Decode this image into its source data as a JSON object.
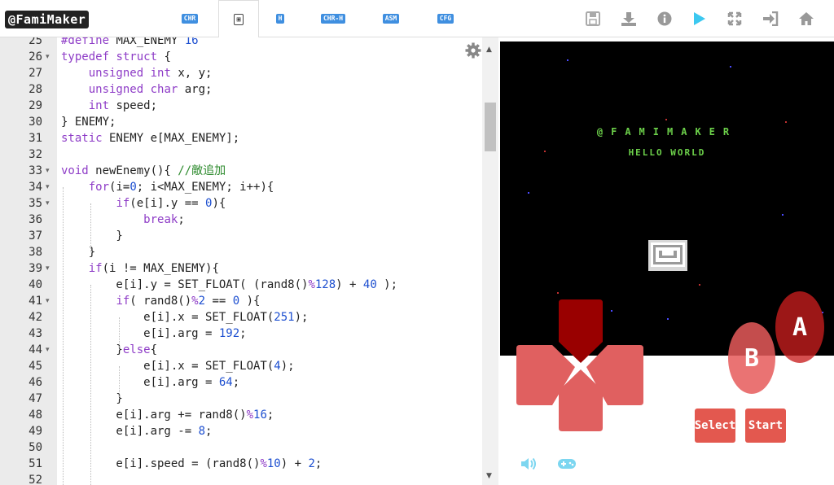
{
  "app": {
    "logo": "@FamiMaker"
  },
  "tabs": [
    {
      "label": "CHR"
    },
    {
      "label": "▣"
    },
    {
      "label": "H"
    },
    {
      "label": "CHR-H"
    },
    {
      "label": "ASM"
    },
    {
      "label": "CFG"
    }
  ],
  "toolbar": {
    "save_icon": "save-icon",
    "download_icon": "download-icon",
    "info_icon": "info-icon",
    "play_icon": "play-icon",
    "fullscreen_icon": "fullscreen-icon",
    "login_icon": "sign-in-icon",
    "home_icon": "home-icon",
    "play_color": "#3cc8f0"
  },
  "editor": {
    "lines": [
      {
        "n": "25",
        "fold": "",
        "html": "<span class='op'>#define</span> MAX_ENEMY <span class='num'>16</span>"
      },
      {
        "n": "26",
        "fold": "▾",
        "html": "<span class='kw'>typedef</span> <span class='kw'>struct</span> {"
      },
      {
        "n": "27",
        "fold": "",
        "html": "    <span class='kw'>unsigned</span> <span class='kw'>int</span> x, y;"
      },
      {
        "n": "28",
        "fold": "",
        "html": "    <span class='kw'>unsigned</span> <span class='kw'>char</span> arg;"
      },
      {
        "n": "29",
        "fold": "",
        "html": "    <span class='kw'>int</span> speed;"
      },
      {
        "n": "30",
        "fold": "",
        "html": "} ENEMY;"
      },
      {
        "n": "31",
        "fold": "",
        "html": "<span class='kw'>static</span> ENEMY e[MAX_ENEMY];"
      },
      {
        "n": "32",
        "fold": "",
        "html": ""
      },
      {
        "n": "33",
        "fold": "▾",
        "html": "<span class='kw'>void</span> newEnemy(){ <span class='cm'>//敵追加</span>"
      },
      {
        "n": "34",
        "fold": "▾",
        "html": "    <span class='kw'>for</span>(i=<span class='num'>0</span>; i&lt;MAX_ENEMY; i++){"
      },
      {
        "n": "35",
        "fold": "▾",
        "html": "        <span class='kw'>if</span>(e[i].y == <span class='num'>0</span>){"
      },
      {
        "n": "36",
        "fold": "",
        "html": "            <span class='kw'>break</span>;"
      },
      {
        "n": "37",
        "fold": "",
        "html": "        }"
      },
      {
        "n": "38",
        "fold": "",
        "html": "    }"
      },
      {
        "n": "39",
        "fold": "▾",
        "html": "    <span class='kw'>if</span>(i != MAX_ENEMY){"
      },
      {
        "n": "40",
        "fold": "",
        "html": "        e[i].y = SET_FLOAT( (rand8()<span class='op'>%</span><span class='num'>128</span>) + <span class='num'>40</span> );"
      },
      {
        "n": "41",
        "fold": "▾",
        "html": "        <span class='kw'>if</span>( rand8()<span class='op'>%</span><span class='num'>2</span> == <span class='num'>0</span> ){"
      },
      {
        "n": "42",
        "fold": "",
        "html": "            e[i].x = SET_FLOAT(<span class='num'>251</span>);"
      },
      {
        "n": "43",
        "fold": "",
        "html": "            e[i].arg = <span class='num'>192</span>;"
      },
      {
        "n": "44",
        "fold": "▾",
        "html": "        }<span class='kw'>else</span>{"
      },
      {
        "n": "45",
        "fold": "",
        "html": "            e[i].x = SET_FLOAT(<span class='num'>4</span>);"
      },
      {
        "n": "46",
        "fold": "",
        "html": "            e[i].arg = <span class='num'>64</span>;"
      },
      {
        "n": "47",
        "fold": "",
        "html": "        }"
      },
      {
        "n": "48",
        "fold": "",
        "html": "        e[i].arg += rand8()<span class='op'>%</span><span class='num'>16</span>;"
      },
      {
        "n": "49",
        "fold": "",
        "html": "        e[i].arg -= <span class='num'>8</span>;"
      },
      {
        "n": "50",
        "fold": "",
        "html": ""
      },
      {
        "n": "51",
        "fold": "",
        "html": "        e[i].speed = (rand8()<span class='op'>%</span><span class='num'>10</span>) + <span class='num'>2</span>;"
      },
      {
        "n": "52",
        "fold": "",
        "html": ""
      }
    ]
  },
  "game": {
    "title_line1": "@FAMIMAKER",
    "title_line2": "HELLO WORLD",
    "text_color": "#6cd04a"
  },
  "controls": {
    "a_label": "A",
    "b_label": "B",
    "select_label": "Select",
    "start_label": "Start",
    "sound_icon": "speaker-icon",
    "gamepad_icon": "gamepad-icon"
  }
}
